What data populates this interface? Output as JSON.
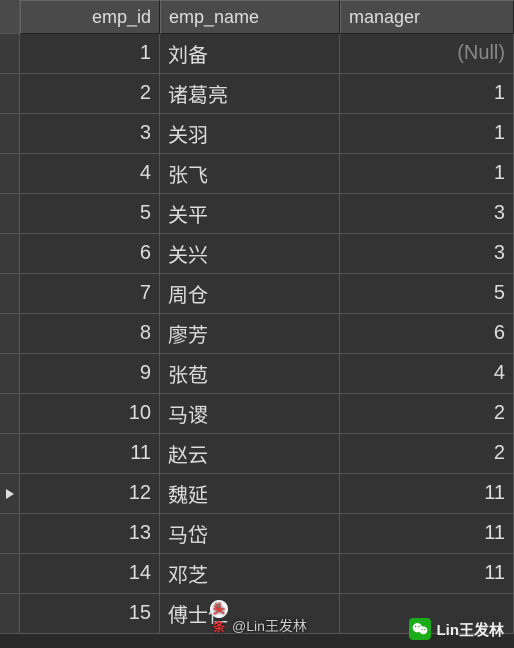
{
  "columns": {
    "emp_id": "emp_id",
    "emp_name": "emp_name",
    "manager": "manager"
  },
  "null_display": "(Null)",
  "rows": [
    {
      "emp_id": "1",
      "emp_name": "刘备",
      "manager": null
    },
    {
      "emp_id": "2",
      "emp_name": "诸葛亮",
      "manager": "1"
    },
    {
      "emp_id": "3",
      "emp_name": "关羽",
      "manager": "1"
    },
    {
      "emp_id": "4",
      "emp_name": "张飞",
      "manager": "1"
    },
    {
      "emp_id": "5",
      "emp_name": "关平",
      "manager": "3"
    },
    {
      "emp_id": "6",
      "emp_name": "关兴",
      "manager": "3"
    },
    {
      "emp_id": "7",
      "emp_name": "周仓",
      "manager": "5"
    },
    {
      "emp_id": "8",
      "emp_name": "廖芳",
      "manager": "6"
    },
    {
      "emp_id": "9",
      "emp_name": "张苞",
      "manager": "4"
    },
    {
      "emp_id": "10",
      "emp_name": "马谡",
      "manager": "2"
    },
    {
      "emp_id": "11",
      "emp_name": "赵云",
      "manager": "2"
    },
    {
      "emp_id": "12",
      "emp_name": "魏延",
      "manager": "11"
    },
    {
      "emp_id": "13",
      "emp_name": "马岱",
      "manager": "11"
    },
    {
      "emp_id": "14",
      "emp_name": "邓芝",
      "manager": "11"
    },
    {
      "emp_id": "15",
      "emp_name": "傅士仁",
      "manager": ""
    }
  ],
  "current_row_index": 11,
  "watermark": {
    "label": "Lin王发林"
  },
  "attribution": {
    "prefix": "头条",
    "text": "@Lin王发林"
  }
}
